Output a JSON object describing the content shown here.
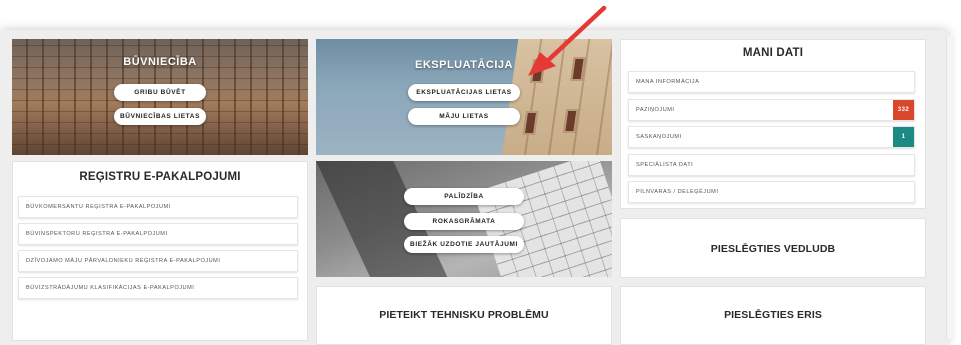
{
  "buvnieciba": {
    "title": "BŪVNIECĪBA",
    "buttons": [
      "GRIBU BŪVĒT",
      "BŪVNIECĪBAS LIETAS"
    ]
  },
  "ekspluatacija": {
    "title": "EKSPLUATĀCIJA",
    "buttons": [
      "EKSPLUATĀCIJAS LIETAS",
      "MĀJU LIETAS"
    ]
  },
  "mani_dati": {
    "title": "MANI DATI",
    "items": [
      {
        "label": "MANA INFORMĀCIJA"
      },
      {
        "label": "PAZIŅOJUMI",
        "badge": "332",
        "badge_color": "#d9472b"
      },
      {
        "label": "SASKAŅOJUMI",
        "badge": "1",
        "badge_color": "#1b8a82"
      },
      {
        "label": "SPECIĀLISTA DATI"
      },
      {
        "label": "PILNVARAS / DELEĢĒJUMI"
      }
    ]
  },
  "registri": {
    "title": "REĢISTRU E-PAKALPOJUMI",
    "items": [
      "BŪVKOMERSANTU REĢISTRA E-PAKALPOJUMI",
      "BŪVINSPEKTORU REĢISTRA E-PAKALPOJUMI",
      "DZĪVOJAMO MĀJU PĀRVALDNIEKU REĢISTRA E-PAKALPOJUMI",
      "BŪVIZSTRĀDĀJUMU KLASIFIKĀCIJAS E-PAKALPOJUMI"
    ]
  },
  "palidziba": {
    "buttons": [
      "PALĪDZĪBA",
      "ROKASGRĀMATA",
      "BIEŽĀK UZDOTIE JAUTĀJUMI"
    ]
  },
  "links": {
    "vedludb": "PIESLĒGTIES VEDLUDB",
    "problem": "PIETEIKT TEHNISKU PROBLĒMU",
    "eris": "PIESLĒGTIES ERIS"
  },
  "colors": {
    "annotation_arrow": "#e53935",
    "badge_red": "#d9472b",
    "badge_teal": "#1b8a82"
  }
}
